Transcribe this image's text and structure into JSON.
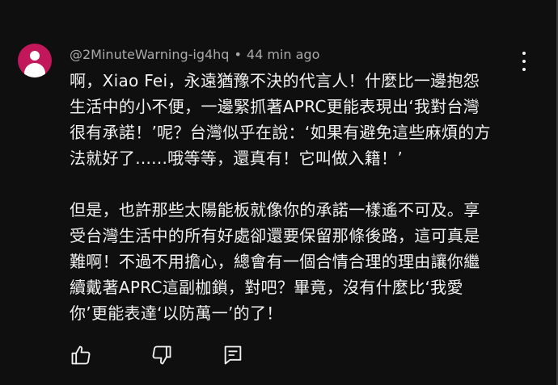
{
  "comment": {
    "author": "@2MinuteWarning-ig4hq",
    "separator": "•",
    "time": "44 min ago",
    "avatar_color": "#c2185b",
    "paragraphs": [
      "啊，Xiao Fei，永遠猶豫不決的代言人！什麼比一邊抱怨\n生活中的小不便，一邊緊抓著APRC更能表現出‘我對台灣\n很有承諾！’呢？台灣似乎在說：‘如果有避免這些麻煩的方\n法就好了......哦等等，還真有！它叫做入籍！’",
      "但是，也許那些太陽能板就像你的承諾一樣遙不可及。享\n受台灣生活中的所有好處卻還要保留那條後路，這可真是\n難啊！不過不用擔心，總會有一個合情合理的理由讓你繼\n續戴著APRC這副枷鎖，對吧？畢竟，沒有什麼比‘我愛\n你’更能表達‘以防萬一’的了！"
    ],
    "actions": {
      "like_icon": "thumbs-up-icon",
      "dislike_icon": "thumbs-down-icon",
      "reply_icon": "reply-comment-icon",
      "menu_icon": "more-vertical-icon"
    }
  },
  "colors": {
    "background": "#0f0f0f",
    "text": "#f1f1f1",
    "meta": "#aaaaaa"
  }
}
